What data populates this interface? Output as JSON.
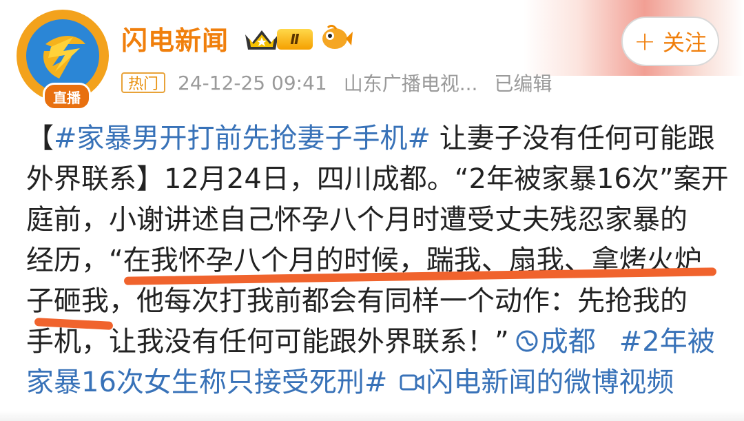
{
  "account": {
    "name": "闪电新闻",
    "live_badge": "直播",
    "level": "Ⅱ"
  },
  "follow_button": {
    "plus": "+",
    "label": "关注"
  },
  "meta": {
    "tag": "热门",
    "timestamp": "24-12-25 09:41",
    "source": "山东广播电视...",
    "edited": "已编辑"
  },
  "post": {
    "line1_a": "【",
    "line1_tag": "#家暴男开打前先抢妻子手机#",
    "line1_b": " 让妻子没有任何可能跟",
    "line2": "外界联系】12月24日，四川成都。“2年被家暴16次”案开",
    "line3": "庭前，小谢讲述自己怀孕八个月时遭受丈夫残忍家暴的",
    "line4": "经历，“在我怀孕八个月的时候，踹我、扇我、拿烤火炉",
    "line5": "子砸我，他每次打我前都会有同样一个动作：先抢我的",
    "line6_a": "手机，让我没有任何可能跟外界联系！”",
    "line6_location": "成都",
    "line6_tag": "#2年被",
    "line7_tag": "家暴16次女生称只接受死刑#",
    "line7_video": "闪电新闻的微博视频"
  },
  "colors": {
    "brand_orange": "#f07f0c",
    "link_blue": "#3872b8",
    "underline_red": "#f0632d",
    "meta_gray": "#9a9a9a"
  },
  "icons": [
    "lightning-logo-icon",
    "crown-icon",
    "fish-emoji-icon",
    "location-icon",
    "video-icon"
  ]
}
